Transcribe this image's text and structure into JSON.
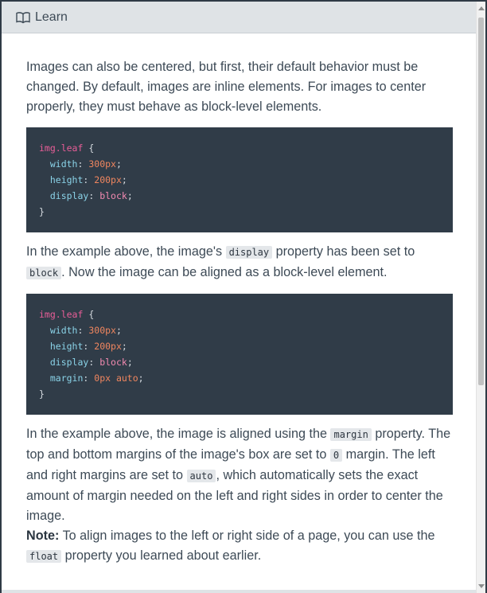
{
  "header": {
    "icon": "book-icon",
    "title": "Learn"
  },
  "intro": "Images can also be centered, but first, their default behavior must be changed. By default, images are inline elements. For images to center properly, they must behave as block-level elements.",
  "code1": {
    "selector": "img.leaf",
    "lines": [
      {
        "prop": "width",
        "val": "300px"
      },
      {
        "prop": "height",
        "val": "200px"
      },
      {
        "prop": "display",
        "val": "block"
      }
    ]
  },
  "para2": {
    "t1": "In the example above, the image's ",
    "c1": "display",
    "t2": " property has been set to ",
    "c2": "block",
    "t3": ". Now the image can be aligned as a block-level element."
  },
  "code2": {
    "selector": "img.leaf",
    "lines": [
      {
        "prop": "width",
        "val": "300px"
      },
      {
        "prop": "height",
        "val": "200px"
      },
      {
        "prop": "display",
        "val": "block"
      },
      {
        "prop": "margin",
        "val": "0px auto"
      }
    ]
  },
  "para3": {
    "t1": "In the example above, the image is aligned using the ",
    "c1": "margin",
    "t2": " property. The top and bottom margins of the image's box are set to ",
    "c2": "0",
    "t3": " margin. The left and right margins are set to ",
    "c3": "auto",
    "t4": ", which automatically sets the exact amount of margin needed on the left and right sides in order to center the image."
  },
  "note": {
    "label": "Note:",
    "t1": " To align images to the left or right side of a page, you can use the ",
    "c1": "float",
    "t2": " property you learned about earlier."
  },
  "colors": {
    "code_bg": "#303c48",
    "header_bg": "#dfe3e6",
    "text": "#3d4a56"
  }
}
